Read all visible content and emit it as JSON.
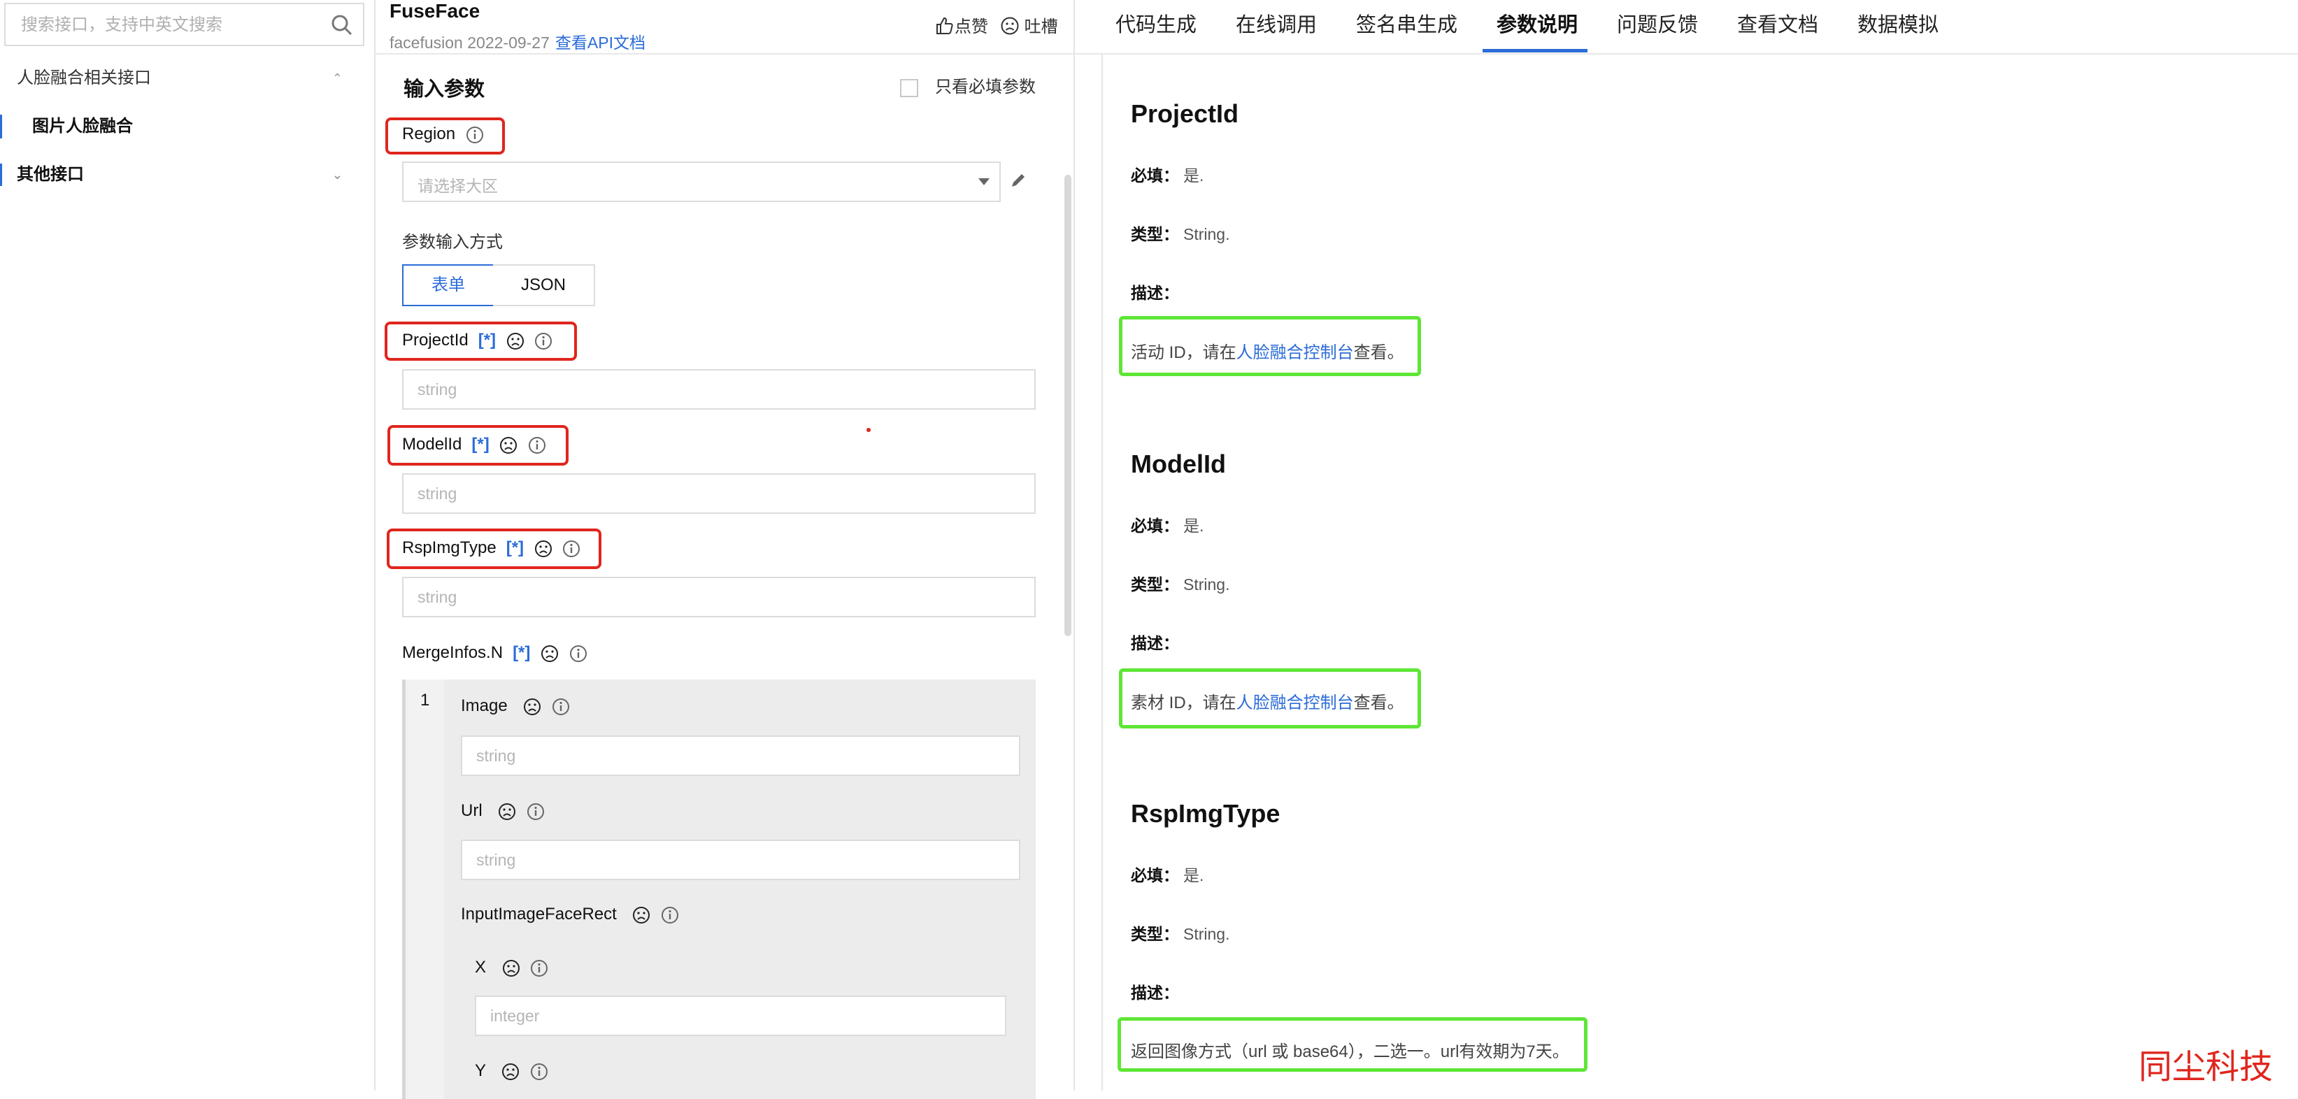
{
  "sidebar": {
    "search_placeholder": "搜索接口，支持中英文搜索",
    "groups": [
      {
        "label": "人脸融合相关接口",
        "expanded": true,
        "items": [
          {
            "label": "图片人脸融合",
            "active": true
          }
        ]
      },
      {
        "label": "其他接口",
        "expanded": false,
        "items": []
      }
    ]
  },
  "middle": {
    "api_name": "FuseFace",
    "api_meta": "facefusion 2022-09-27",
    "api_doc_link": "查看API文档",
    "like_label": "点赞",
    "roast_label": "吐槽",
    "input_params_title": "输入参数",
    "required_only_label": "只看必填参数",
    "region": {
      "label": "Region",
      "placeholder": "请选择大区"
    },
    "input_mode": {
      "label": "参数输入方式",
      "options": [
        "表单",
        "JSON"
      ],
      "selected": "表单"
    },
    "required_mark": "[*]",
    "params": [
      {
        "name": "ProjectId",
        "required": true,
        "placeholder": "string"
      },
      {
        "name": "ModelId",
        "required": true,
        "placeholder": "string"
      },
      {
        "name": "RspImgType",
        "required": true,
        "placeholder": "string"
      }
    ],
    "merge_infos": {
      "label": "MergeInfos.N",
      "index": "1",
      "fields": [
        {
          "name": "Image",
          "placeholder": "string"
        },
        {
          "name": "Url",
          "placeholder": "string"
        },
        {
          "name": "InputImageFaceRect"
        },
        {
          "name": "X",
          "placeholder": "integer"
        },
        {
          "name": "Y"
        }
      ]
    }
  },
  "right": {
    "tabs": [
      "代码生成",
      "在线调用",
      "签名串生成",
      "参数说明",
      "问题反馈",
      "查看文档",
      "数据模拟"
    ],
    "active_tab": "参数说明",
    "params": [
      {
        "title": "ProjectId",
        "required_label": "必填：",
        "required_value": "是.",
        "type_label": "类型：",
        "type_value": "String.",
        "desc_label": "描述：",
        "desc_pre": "活动 ID，请在",
        "desc_link": "人脸融合控制台",
        "desc_post": "查看。"
      },
      {
        "title": "ModelId",
        "required_label": "必填：",
        "required_value": "是.",
        "type_label": "类型：",
        "type_value": "String.",
        "desc_label": "描述：",
        "desc_pre": "素材 ID，请在",
        "desc_link": "人脸融合控制台",
        "desc_post": "查看。"
      },
      {
        "title": "RspImgType",
        "required_label": "必填：",
        "required_value": "是.",
        "type_label": "类型：",
        "type_value": "String.",
        "desc_label": "描述：",
        "desc_pre": "返回图像方式（url 或 base64），二选一。url有效期为7天。",
        "desc_link": "",
        "desc_post": ""
      }
    ]
  },
  "watermark": "同尘科技",
  "colors": {
    "accent": "#2b6cd8",
    "highlight_red": "#e0261e",
    "highlight_green": "#5ee636"
  },
  "icons": [
    "search-icon",
    "chevron-up-icon",
    "chevron-down-icon",
    "thumbs-up-icon",
    "frown-icon",
    "info-icon",
    "edit-pencil-icon",
    "dropdown-caret-icon"
  ]
}
